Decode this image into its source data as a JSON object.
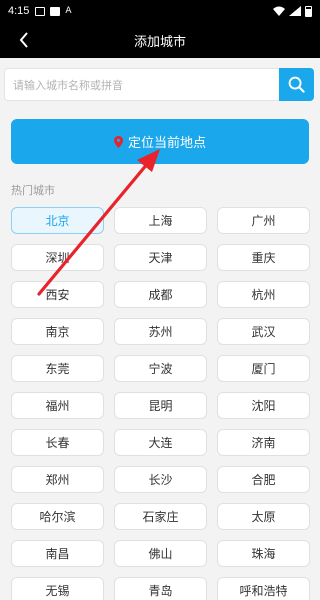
{
  "status_bar": {
    "time": "4:15",
    "icons": [
      "image-icon",
      "square-icon",
      "a-icon",
      "wifi-icon",
      "signal-icon",
      "battery-icon"
    ]
  },
  "header": {
    "title": "添加城市",
    "back_icon": "chevron-left-icon"
  },
  "search": {
    "placeholder": "请输入城市名称或拼音",
    "icon": "search-icon"
  },
  "locate": {
    "label": "定位当前地点",
    "icon": "location-pin-icon",
    "color": "#1aa7ec"
  },
  "hot_cities": {
    "title": "热门城市",
    "selected": "北京",
    "cities": [
      "北京",
      "上海",
      "广州",
      "深圳",
      "天津",
      "重庆",
      "西安",
      "成都",
      "杭州",
      "南京",
      "苏州",
      "武汉",
      "东莞",
      "宁波",
      "厦门",
      "福州",
      "昆明",
      "沈阳",
      "长春",
      "大连",
      "济南",
      "郑州",
      "长沙",
      "合肥",
      "哈尔滨",
      "石家庄",
      "太原",
      "南昌",
      "佛山",
      "珠海",
      "无锡",
      "青岛",
      "呼和浩特"
    ]
  },
  "colors": {
    "accent": "#1aa7ec",
    "annotation_arrow": "#e8232a"
  }
}
